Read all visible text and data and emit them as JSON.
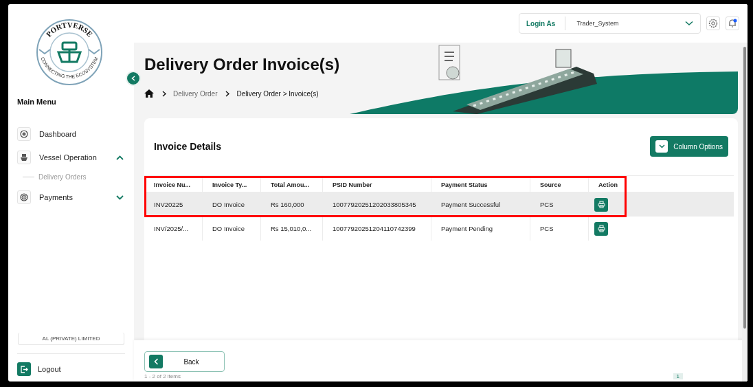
{
  "logo": {
    "name": "PORTVERSE",
    "tagline": "CONNECTING THE ECOSYSTEM"
  },
  "sidebar": {
    "menu_title": "Main Menu",
    "items": [
      {
        "label": "Dashboard"
      },
      {
        "label": "Vessel Operation",
        "expanded": true,
        "children": [
          {
            "label": "Delivery Orders"
          }
        ]
      },
      {
        "label": "Payments",
        "expanded": false
      }
    ],
    "company": "AL (PRIVATE) LIMITED",
    "logout": "Logout"
  },
  "topbar": {
    "login_label": "Login As",
    "login_value": "Trader_System",
    "notification_dot": true
  },
  "page": {
    "title": "Delivery Order Invoice(s)",
    "breadcrumb": [
      {
        "label": "Delivery Order",
        "current": false
      },
      {
        "label": "Delivery Order > Invoice(s)",
        "current": true
      }
    ]
  },
  "card": {
    "title": "Invoice Details",
    "column_options": "Column Options"
  },
  "table": {
    "columns": [
      "Invoice Nu...",
      "Invoice Ty...",
      "Total Amou...",
      "PSID Number",
      "Payment Status",
      "Source",
      "Action"
    ],
    "rows": [
      {
        "selected": true,
        "cells": [
          "INV20225",
          "DO Invoice",
          "Rs 160,000",
          "10077920251202033805345",
          "Payment Successful",
          "PCS"
        ]
      },
      {
        "selected": false,
        "cells": [
          "INV/2025/...",
          "DO Invoice",
          "Rs 15,010,0...",
          "10077920251204110742399",
          "Payment Pending",
          "PCS"
        ]
      }
    ]
  },
  "pagination": {
    "summary": "1 - 2 of 2 items",
    "page": "1"
  },
  "footer": {
    "back": "Back"
  }
}
